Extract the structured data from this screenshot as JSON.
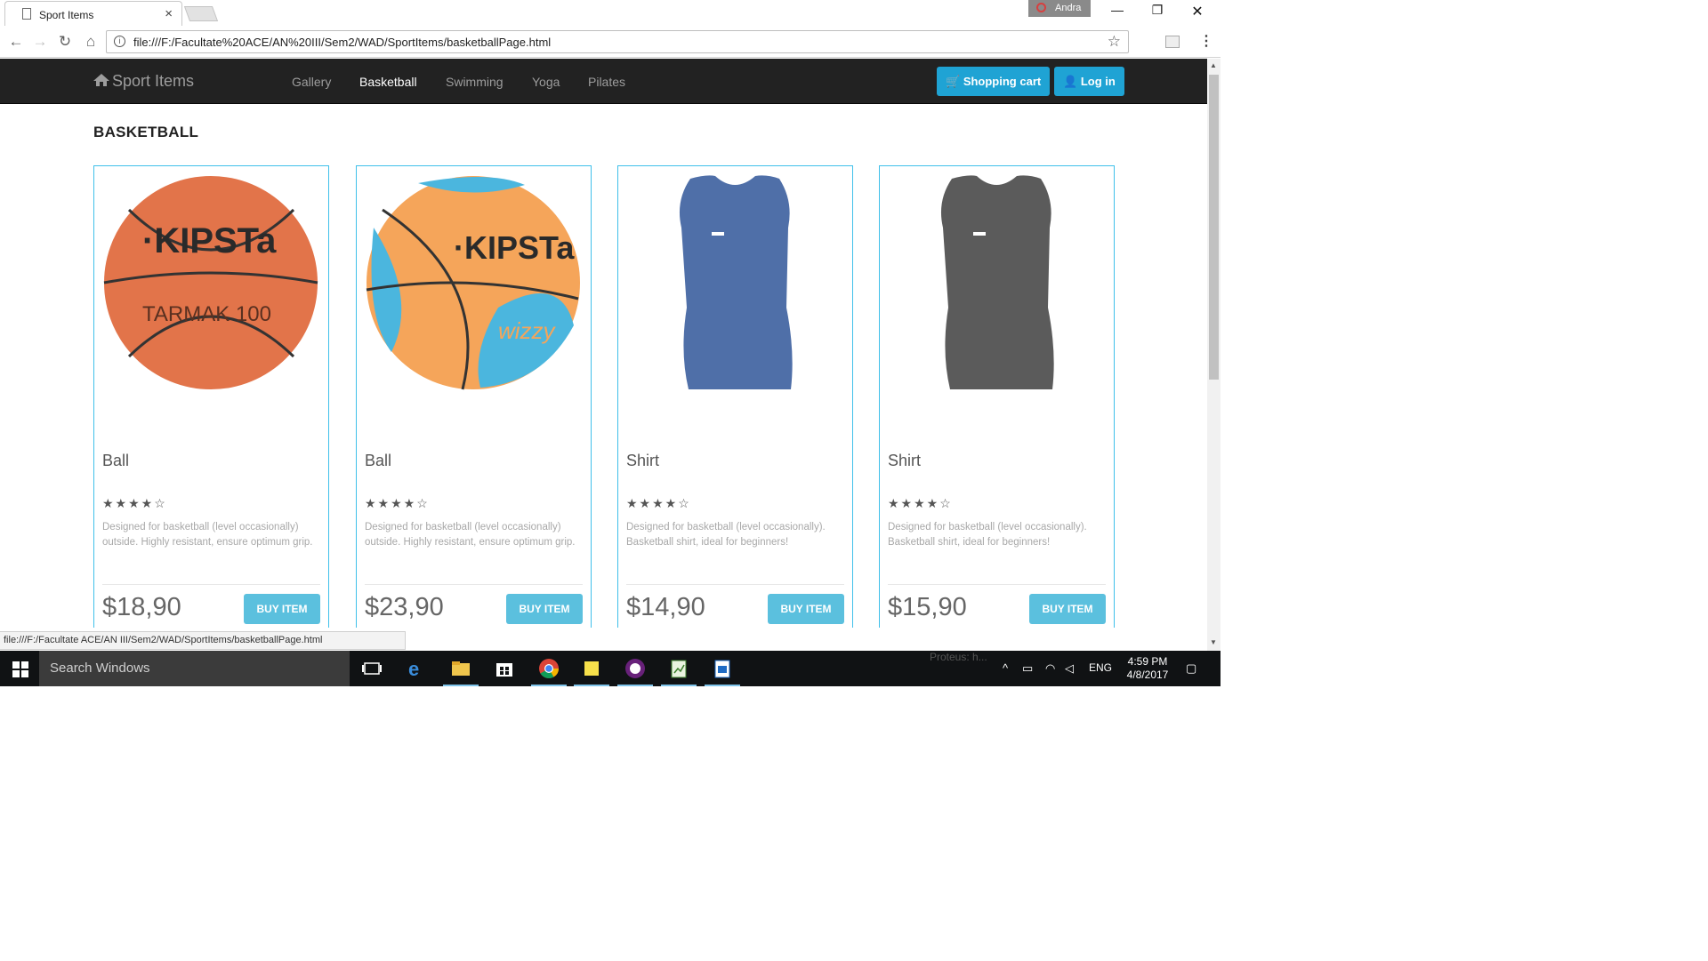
{
  "browser": {
    "tab_title": "Sport Items",
    "user_name": "Andra",
    "url": "file:///F:/Facultate%20ACE/AN%20III/Sem2/WAD/SportItems/basketballPage.html",
    "status_url": "file:///F:/Facultate ACE/AN III/Sem2/WAD/SportItems/basketballPage.html"
  },
  "site": {
    "brand": "Sport Items",
    "nav": [
      "Gallery",
      "Basketball",
      "Swimming",
      "Yoga",
      "Pilates"
    ],
    "active_nav": "Basketball",
    "cart_label": "Shopping cart",
    "login_label": "Log in",
    "section_title": "BASKETBALL",
    "buy_label": "BUY ITEM",
    "products": [
      {
        "name": "Ball",
        "rating": 4,
        "stars": "★★★★☆",
        "description": "Designed for basketball (level occasionally) outside. Highly resistant, ensure optimum grip.",
        "price": "$18,90",
        "image": "orange-basketball-kipsta-tarmak-100"
      },
      {
        "name": "Ball",
        "rating": 4,
        "stars": "★★★★☆",
        "description": "Designed for basketball (level occasionally) outside. Highly resistant, ensure optimum grip.",
        "price": "$23,90",
        "image": "blue-orange-basketball-kipsta-wizzy"
      },
      {
        "name": "Shirt",
        "rating": 4,
        "stars": "★★★★☆",
        "description": "Designed for basketball (level occasionally). Basketball shirt, ideal for beginners!",
        "price": "$14,90",
        "image": "blue-basketball-shirt"
      },
      {
        "name": "Shirt",
        "rating": 4,
        "stars": "★★★★☆",
        "description": "Designed for basketball (level occasionally). Basketball shirt, ideal for beginners!",
        "price": "$15,90",
        "image": "gray-basketball-shirt"
      }
    ]
  },
  "taskbar": {
    "search_placeholder": "Search Windows",
    "language": "ENG",
    "time": "4:59 PM",
    "date": "4/8/2017",
    "notification_text": "Proteus: h..."
  },
  "colors": {
    "navbar_bg": "#222222",
    "accent_button": "#1fa3d4",
    "buy_button": "#5bc0de",
    "card_border": "#3fc0ea"
  }
}
